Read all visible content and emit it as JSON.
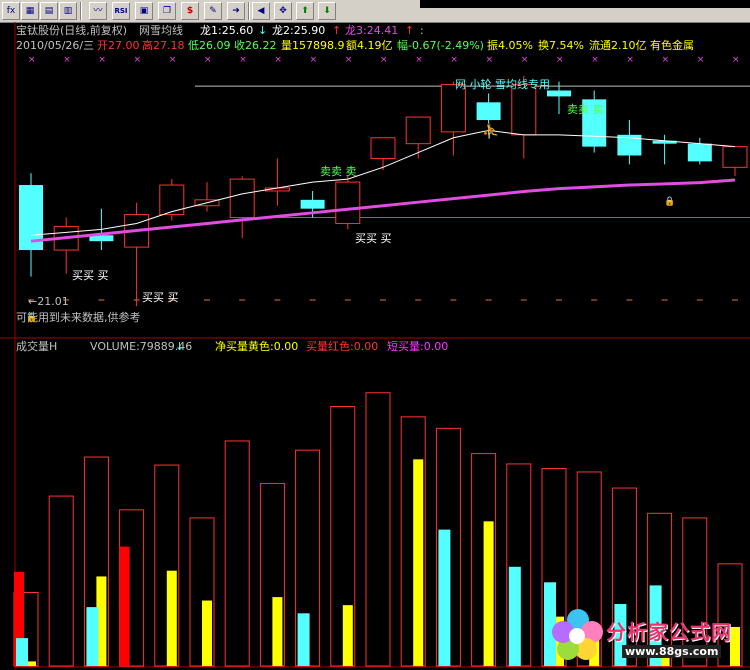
{
  "toolbar": {
    "icons": [
      "fx-icon",
      "chart-icon",
      "grid-icon",
      "grid-icon",
      "line-chart-icon",
      "rsi-icon",
      "info-icon",
      "window-icon",
      "dollar-icon",
      "tools-icon",
      "exit-icon",
      "move-icon",
      "arrow-up-icon",
      "arrow-down-icon"
    ],
    "fx_label": "fx",
    "rsi_label": "RSI",
    "dollar_label": "$"
  },
  "info_line1": {
    "stock": "宝钛股份(日线,前复权)",
    "indicator": "网雪均线",
    "long1": "龙1:25.60",
    "long2": "龙2:25.90",
    "long3": "龙3:24.41",
    "dot": ":"
  },
  "info_line2": {
    "date": "2010/05/26/三",
    "open": "开27.00",
    "high": "高27.18",
    "low": "低26.09",
    "close": "收26.22",
    "volume": "量157898.9",
    "amount": "额4.19亿",
    "change": "幅-0.67(-2.49%)",
    "amplitude": "振4.05%",
    "turnover": "换7.54%",
    "float_shares": "流通2.10亿",
    "sector": "有色金属"
  },
  "annotations": {
    "title_band": "网 小轮 雪均线专用",
    "sell_1": "卖卖 卖",
    "sell_2": "卖卖 卖",
    "buy_1": "买买 买",
    "buy_2": "买买 买",
    "buy_3": "买买 买",
    "low_marker": "←21.01",
    "disclaimer": "可能用到未来数据,供参考"
  },
  "volume_panel": {
    "title": "成交量H",
    "volume": "VOLUME:79889.46",
    "net_buy": "净买量黄色:0.00",
    "buy": "买量红色:0.00",
    "short_buy": "短买量:0.00"
  },
  "colors": {
    "up": "#ff3333",
    "down": "#54ffff",
    "ma_white": "#ffffff",
    "ma_magenta": "#e14ce1",
    "net_buy": "#ffff00",
    "buy": "#ff0000",
    "short_buy": "#ff33ff"
  },
  "logo": {
    "name": "分析家公式网",
    "url": "www.88gs.com"
  },
  "chart_data": [
    {
      "type": "candlestick",
      "candles": [
        {
          "o": 25.1,
          "h": 25.5,
          "l": 22.0,
          "c": 22.9
        },
        {
          "o": 22.9,
          "h": 24.0,
          "l": 22.1,
          "c": 23.7
        },
        {
          "o": 23.4,
          "h": 24.3,
          "l": 22.9,
          "c": 23.2
        },
        {
          "o": 23.0,
          "h": 24.5,
          "l": 21.0,
          "c": 24.1
        },
        {
          "o": 24.1,
          "h": 25.3,
          "l": 23.9,
          "c": 25.1
        },
        {
          "o": 24.4,
          "h": 25.2,
          "l": 24.2,
          "c": 24.6
        },
        {
          "o": 24.0,
          "h": 25.4,
          "l": 23.3,
          "c": 25.3
        },
        {
          "o": 24.9,
          "h": 26.0,
          "l": 24.4,
          "c": 25.0
        },
        {
          "o": 24.6,
          "h": 24.9,
          "l": 24.0,
          "c": 24.3
        },
        {
          "o": 23.8,
          "h": 25.4,
          "l": 23.6,
          "c": 25.2
        },
        {
          "o": 26.0,
          "h": 26.7,
          "l": 25.6,
          "c": 26.7
        },
        {
          "o": 26.5,
          "h": 27.2,
          "l": 26.0,
          "c": 27.4
        },
        {
          "o": 26.9,
          "h": 28.6,
          "l": 26.1,
          "c": 28.5
        },
        {
          "o": 27.9,
          "h": 28.2,
          "l": 26.8,
          "c": 27.3
        },
        {
          "o": 26.8,
          "h": 28.8,
          "l": 26.0,
          "c": 28.5
        },
        {
          "o": 28.3,
          "h": 28.6,
          "l": 27.5,
          "c": 28.1
        },
        {
          "o": 28.0,
          "h": 28.3,
          "l": 26.2,
          "c": 26.4
        },
        {
          "o": 26.8,
          "h": 27.3,
          "l": 25.8,
          "c": 26.1
        },
        {
          "o": 26.6,
          "h": 26.8,
          "l": 25.8,
          "c": 26.5
        },
        {
          "o": 26.5,
          "h": 26.7,
          "l": 25.8,
          "c": 25.9
        },
        {
          "o": 25.7,
          "h": 26.4,
          "l": 25.4,
          "c": 26.4
        }
      ],
      "ma_white": [
        23.4,
        23.5,
        23.6,
        23.8,
        24.2,
        24.5,
        24.8,
        25.0,
        25.2,
        25.3,
        25.7,
        26.2,
        26.7,
        26.95,
        26.8,
        26.8,
        26.75,
        26.7,
        26.6,
        26.5,
        26.4
      ],
      "ma_magenta": [
        23.2,
        23.32,
        23.44,
        23.56,
        23.68,
        23.8,
        23.92,
        24.04,
        24.16,
        24.28,
        24.4,
        24.52,
        24.64,
        24.76,
        24.88,
        24.98,
        25.04,
        25.1,
        25.14,
        25.18,
        25.27
      ],
      "reference_lines": [
        28.45,
        24.0
      ],
      "ylim": [
        20.6,
        29.4
      ]
    },
    {
      "type": "bar",
      "title": "成交量H",
      "volume": [
        64000,
        148000,
        182000,
        136000,
        175000,
        129000,
        196000,
        159000,
        188000,
        226000,
        238000,
        217000,
        207000,
        185000,
        176000,
        172000,
        169000,
        155000,
        133000,
        129000,
        89000
      ],
      "net_buy": [
        4000,
        0,
        78000,
        0,
        83000,
        57000,
        0,
        60000,
        0,
        53000,
        0,
        180000,
        0,
        126000,
        0,
        43000,
        36000,
        0,
        10000,
        0,
        34000
      ],
      "buy": [
        82000,
        0,
        0,
        104000,
        0,
        0,
        0,
        0,
        0,
        0,
        0,
        0,
        0,
        0,
        0,
        0,
        0,
        0,
        0,
        0,
        0
      ],
      "short_buy": [
        0,
        0,
        0,
        0,
        0,
        0,
        0,
        0,
        0,
        0,
        0,
        0,
        0,
        0,
        0,
        0,
        0,
        0,
        0,
        0,
        0
      ],
      "ylim": [
        0,
        270000
      ]
    }
  ]
}
